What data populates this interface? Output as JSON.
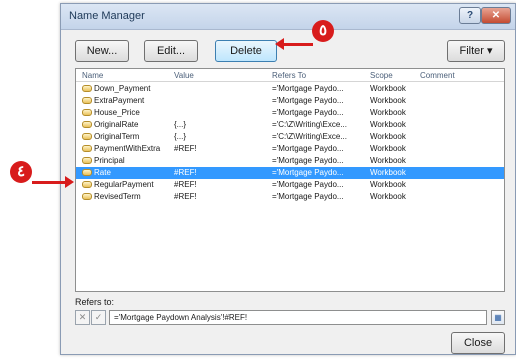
{
  "window": {
    "title": "Name Manager"
  },
  "toolbar": {
    "new_label": "New...",
    "edit_label": "Edit...",
    "delete_label": "Delete",
    "filter_label": "Filter ▾"
  },
  "columns": {
    "name": "Name",
    "value": "Value",
    "refers_to": "Refers To",
    "scope": "Scope",
    "comment": "Comment"
  },
  "rows": [
    {
      "name": "Down_Payment",
      "value": "",
      "refers_to": "='Mortgage Paydo...",
      "scope": "Workbook",
      "comment": "",
      "selected": false
    },
    {
      "name": "ExtraPayment",
      "value": "",
      "refers_to": "='Mortgage Paydo...",
      "scope": "Workbook",
      "comment": "",
      "selected": false
    },
    {
      "name": "House_Price",
      "value": "",
      "refers_to": "='Mortgage Paydo...",
      "scope": "Workbook",
      "comment": "",
      "selected": false
    },
    {
      "name": "OriginalRate",
      "value": "{...}",
      "refers_to": "='C:\\Z\\Writing\\Exce...",
      "scope": "Workbook",
      "comment": "",
      "selected": false
    },
    {
      "name": "OriginalTerm",
      "value": "{...}",
      "refers_to": "='C:\\Z\\Writing\\Exce...",
      "scope": "Workbook",
      "comment": "",
      "selected": false
    },
    {
      "name": "PaymentWithExtra",
      "value": "#REF!",
      "refers_to": "='Mortgage Paydo...",
      "scope": "Workbook",
      "comment": "",
      "selected": false
    },
    {
      "name": "Principal",
      "value": "",
      "refers_to": "='Mortgage Paydo...",
      "scope": "Workbook",
      "comment": "",
      "selected": false
    },
    {
      "name": "Rate",
      "value": "#REF!",
      "refers_to": "='Mortgage Paydo...",
      "scope": "Workbook",
      "comment": "",
      "selected": true
    },
    {
      "name": "RegularPayment",
      "value": "#REF!",
      "refers_to": "='Mortgage Paydo...",
      "scope": "Workbook",
      "comment": "",
      "selected": false
    },
    {
      "name": "RevisedTerm",
      "value": "#REF!",
      "refers_to": "='Mortgage Paydo...",
      "scope": "Workbook",
      "comment": "",
      "selected": false
    }
  ],
  "refers_to_panel": {
    "label": "Refers to:",
    "value": "='Mortgage Paydown Analysis'!#REF!"
  },
  "footer": {
    "close_label": "Close"
  },
  "callouts": {
    "step_delete": "٥",
    "step_select": "٤"
  },
  "colors": {
    "selection": "#3399ff",
    "callout": "#d81c1c"
  }
}
